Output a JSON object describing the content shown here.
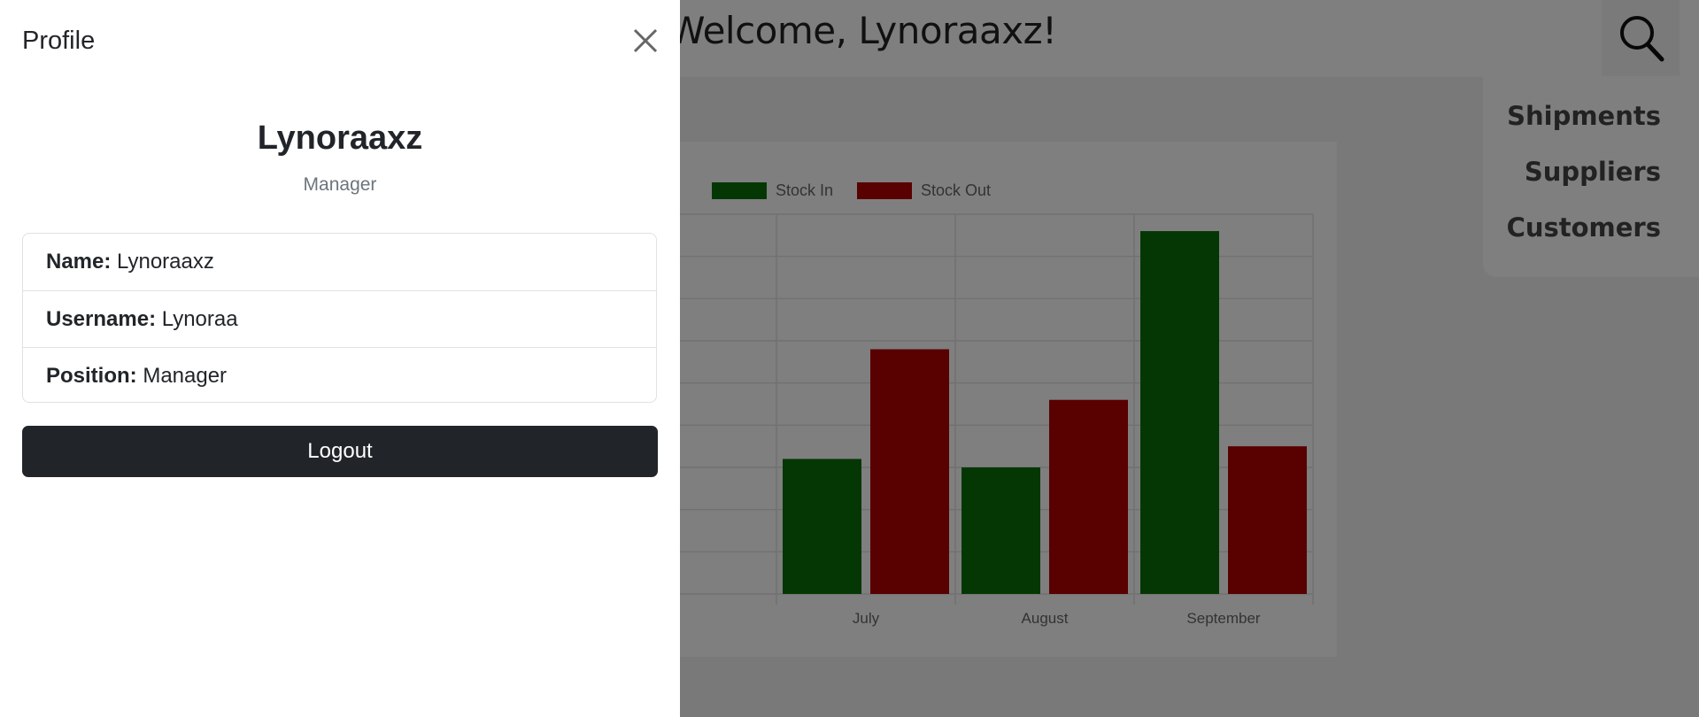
{
  "header": {
    "welcome": "Welcome, Lynoraaxz!",
    "search_icon": "search-icon"
  },
  "nav": {
    "items": [
      {
        "label": "Shipments"
      },
      {
        "label": "Suppliers"
      },
      {
        "label": "Customers"
      }
    ]
  },
  "profile": {
    "title": "Profile",
    "close_icon": "close-icon",
    "display_name": "Lynoraaxz",
    "role": "Manager",
    "fields": [
      {
        "label": "Name:",
        "value": "Lynoraaxz"
      },
      {
        "label": "Username:",
        "value": "Lynoraa"
      },
      {
        "label": "Position:",
        "value": "Manager"
      }
    ],
    "logout_label": "Logout"
  },
  "chart_data": {
    "type": "bar",
    "categories": [
      "July",
      "August",
      "September"
    ],
    "series": [
      {
        "name": "Stock In",
        "color": "#0b6e0b",
        "values": [
          3.2,
          3,
          8.6
        ]
      },
      {
        "name": "Stock Out",
        "color": "#b30000",
        "values": [
          5.8,
          4.6,
          3.5
        ]
      }
    ],
    "ylim": [
      0,
      9
    ],
    "grid": true,
    "legend": "top"
  }
}
